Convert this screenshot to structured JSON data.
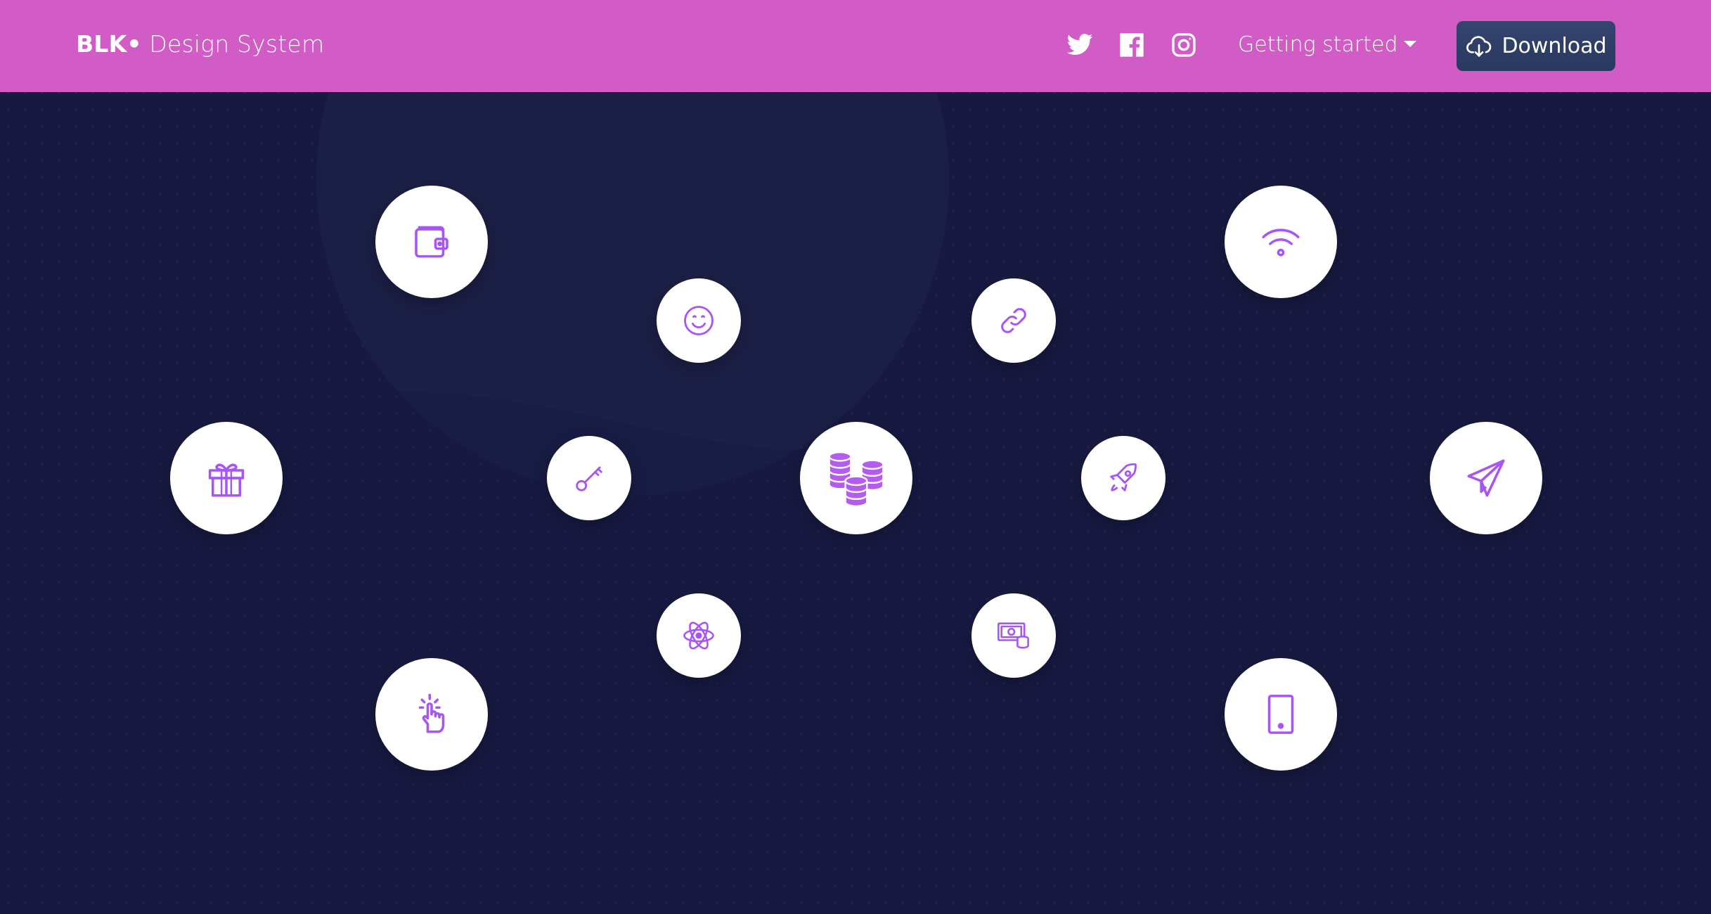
{
  "navbar": {
    "brand_bold": "BLK•",
    "brand_rest": " Design System",
    "social_icons": [
      "twitter-icon",
      "facebook-icon",
      "instagram-icon"
    ],
    "dropdown_label": "Getting started",
    "download_label": "Download",
    "background_color": "#d15cc5",
    "button_color": "#344675"
  },
  "hero": {
    "background_color": "#171941",
    "icon_color": "#a855f7",
    "icons": [
      "wallet-icon",
      "smile-icon",
      "link-icon",
      "wifi-icon",
      "gift-icon",
      "key-icon",
      "coins-icon",
      "rocket-icon",
      "paper-plane-icon",
      "atom-icon",
      "money-coins-icon",
      "tap-finger-icon",
      "tablet-icon"
    ]
  }
}
